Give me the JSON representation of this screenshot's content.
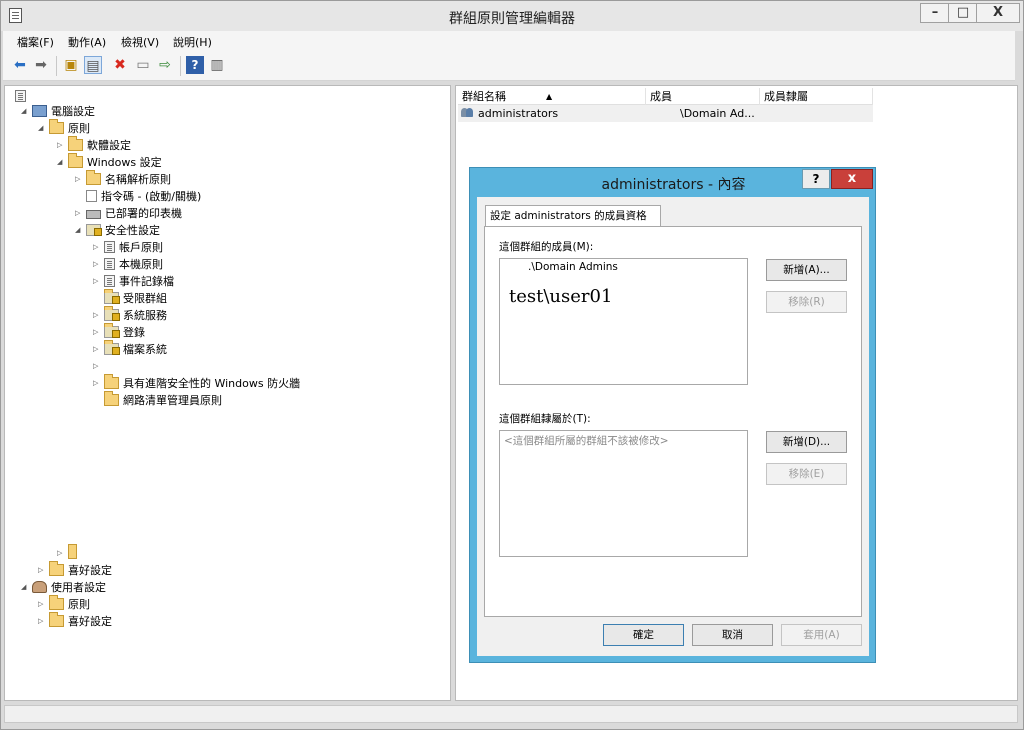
{
  "window": {
    "title": "群組原則管理編輯器",
    "minimize": "–",
    "maximize": "□",
    "close": "X"
  },
  "menu": [
    "檔案(F)",
    "動作(A)",
    "檢視(V)",
    "說明(H)"
  ],
  "toolbar": {
    "icons": [
      "back-icon",
      "forward-icon",
      "up-folder-icon",
      "show-hide-tree-icon",
      "delete-icon",
      "properties-icon",
      "export-list-icon",
      "help-icon",
      "view-icon"
    ]
  },
  "tree": {
    "nodes": [
      {
        "label": "電腦設定"
      },
      {
        "label": "原則"
      },
      {
        "label": "軟體設定"
      },
      {
        "label": "Windows 設定"
      },
      {
        "label": "名稱解析原則"
      },
      {
        "label": "指令碼 - (啟動/關機)"
      },
      {
        "label": "已部署的印表機"
      },
      {
        "label": "安全性設定"
      },
      {
        "label": "帳戶原則"
      },
      {
        "label": "本機原則"
      },
      {
        "label": "事件記錄檔"
      },
      {
        "label": "受限群組"
      },
      {
        "label": "系統服務"
      },
      {
        "label": "登錄"
      },
      {
        "label": "檔案系統"
      },
      {
        "label": ""
      },
      {
        "label": "具有進階安全性的 Windows 防火牆"
      },
      {
        "label": "網路清單管理員原則"
      },
      {
        "label": ""
      },
      {
        "label": "喜好設定"
      },
      {
        "label": "使用者設定"
      },
      {
        "label": "原則"
      },
      {
        "label": "喜好設定"
      }
    ]
  },
  "list": {
    "columns": [
      "群組名稱",
      "成員",
      "成員隸屬"
    ],
    "sort_indicator": "▲",
    "rows": [
      {
        "group": "administrators",
        "members": "\\Domain Ad...",
        "member_of": ""
      }
    ]
  },
  "dialog": {
    "title": "administrators - 內容",
    "help": "?",
    "close": "x",
    "tab": "設定 administrators 的成員資格",
    "members_label": "這個群組的成員(M):",
    "members": [
      ".\\Domain Admins",
      "test\\user01"
    ],
    "add_members": "新增(A)...",
    "remove_members": "移除(R)",
    "member_of_label": "這個群組隸屬於(T):",
    "member_of_placeholder": "<這個群組所屬的群組不該被修改>",
    "add_member_of": "新增(D)...",
    "remove_member_of": "移除(E)",
    "ok": "確定",
    "cancel": "取消",
    "apply": "套用(A)"
  }
}
